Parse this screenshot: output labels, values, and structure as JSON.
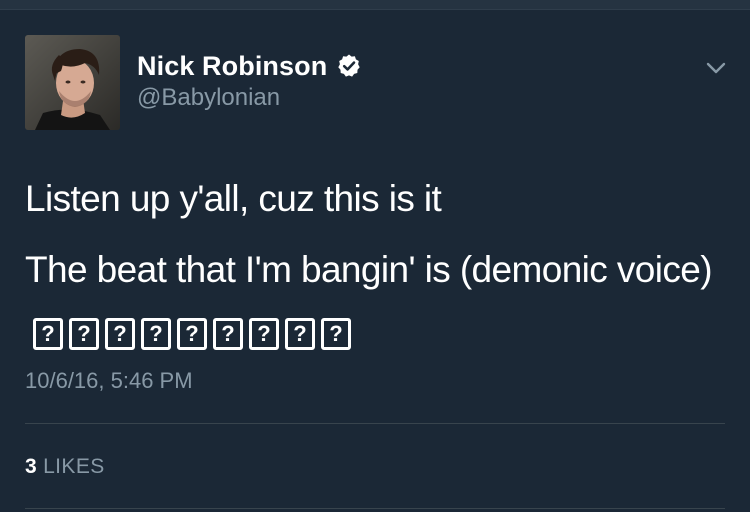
{
  "tweet": {
    "display_name": "Nick Robinson",
    "handle": "@Babylonian",
    "verified": true,
    "text_line1": "Listen up y'all, cuz this is it",
    "text_line2": "The beat that I'm bangin' is (demonic voice)",
    "unrenderable_glyphs": [
      "?",
      "?",
      "?",
      "?",
      "?",
      "?",
      "?",
      "?",
      "?"
    ],
    "timestamp": "10/6/16, 5:46 PM",
    "likes_count": "3",
    "likes_label": "LIKES"
  },
  "icons": {
    "verified": "verified-badge-icon",
    "menu": "chevron-down-icon"
  },
  "colors": {
    "background": "#1b2836",
    "text_primary": "#ffffff",
    "text_secondary": "#8899a6",
    "divider": "#38444d"
  }
}
